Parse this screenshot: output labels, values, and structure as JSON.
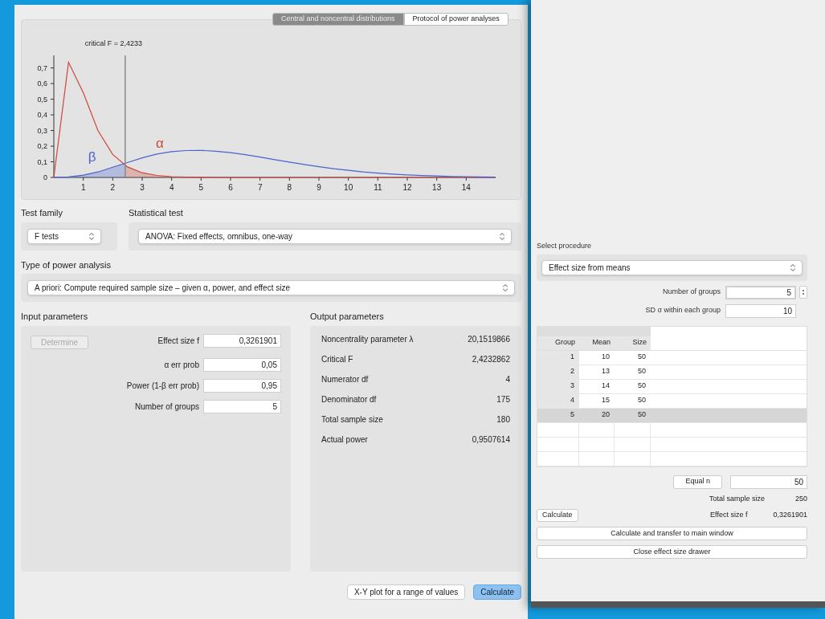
{
  "tabs": [
    {
      "label": "Central and noncentral distributions",
      "selected": true
    },
    {
      "label": "Protocol of power analyses",
      "selected": false
    }
  ],
  "chart": {
    "chart_data": {
      "type": "line",
      "x": [
        0,
        0.5,
        1,
        1.5,
        2,
        2.5,
        3,
        3.5,
        4,
        4.5,
        5,
        5.5,
        6,
        6.5,
        7,
        7.5,
        8,
        8.5,
        9,
        9.5,
        10,
        10.5,
        11,
        11.5,
        12,
        12.5,
        13,
        13.5,
        14,
        14.5,
        15
      ],
      "series": [
        {
          "color": "#d0463c",
          "values": [
            0,
            0.736,
            0.541,
            0.299,
            0.147,
            0.067,
            0.03,
            0.013,
            0.005,
            0.002,
            0.001,
            0,
            0,
            0,
            0,
            0,
            0,
            0,
            0,
            0,
            0,
            0,
            0,
            0,
            0,
            0,
            0,
            0,
            0,
            0,
            0
          ]
        },
        {
          "color": "#4a63d0",
          "values": [
            0,
            0.003,
            0.015,
            0.035,
            0.065,
            0.095,
            0.125,
            0.15,
            0.165,
            0.172,
            0.173,
            0.168,
            0.158,
            0.145,
            0.13,
            0.114,
            0.098,
            0.083,
            0.069,
            0.056,
            0.045,
            0.035,
            0.027,
            0.021,
            0.016,
            0.012,
            0.009,
            0.006,
            0.005,
            0.003,
            0.002
          ]
        }
      ],
      "xlim": [
        0,
        15
      ],
      "ylim": [
        0,
        0.78
      ],
      "xticks": [
        1,
        2,
        3,
        4,
        5,
        6,
        7,
        8,
        9,
        10,
        11,
        12,
        13,
        14
      ],
      "yticks": [
        {
          "value": 0,
          "label": "0"
        },
        {
          "value": 0.1,
          "label": "0,1"
        },
        {
          "value": 0.2,
          "label": "0,2"
        },
        {
          "value": 0.3,
          "label": "0,3"
        },
        {
          "value": 0.4,
          "label": "0,4"
        },
        {
          "value": 0.5,
          "label": "0,5"
        },
        {
          "value": 0.6,
          "label": "0,6"
        },
        {
          "value": 0.7,
          "label": "0,7"
        }
      ],
      "ref_lines": [
        {
          "axis": "x",
          "value": 2.4233,
          "label": "critical F = 2,4233"
        }
      ]
    },
    "area_labels": [
      {
        "text": "β",
        "color": "#4a63d0"
      },
      {
        "text": "α",
        "color": "#d0463c"
      }
    ]
  },
  "test_family": {
    "label": "Test family",
    "value": "F tests"
  },
  "statistical_test": {
    "label": "Statistical test",
    "value": "ANOVA: Fixed effects, omnibus, one-way"
  },
  "power_analysis_type": {
    "label": "Type of power analysis",
    "value": "A priori: Compute required sample size – given α, power, and effect size"
  },
  "input_parameters": {
    "title": "Input parameters",
    "determine_button": {
      "label": "Determine",
      "disabled": true
    },
    "fields": [
      {
        "label": "Effect size f",
        "value": "0,3261901"
      },
      {
        "label": "α err prob",
        "value": "0,05"
      },
      {
        "label": "Power (1-β err prob)",
        "value": "0,95"
      },
      {
        "label": "Number of groups",
        "value": "5"
      }
    ]
  },
  "output_parameters": {
    "title": "Output parameters",
    "rows": [
      {
        "label": "Noncentrality parameter λ",
        "value": "20,1519866"
      },
      {
        "label": "Critical F",
        "value": "2,4232862"
      },
      {
        "label": "Numerator df",
        "value": "4"
      },
      {
        "label": "Denominator df",
        "value": "175"
      },
      {
        "label": "Total sample size",
        "value": "180"
      },
      {
        "label": "Actual power",
        "value": "0,9507614"
      }
    ]
  },
  "buttons": [
    {
      "label": "X-Y plot for a range of values",
      "default": false
    },
    {
      "label": "Calculate",
      "default": true
    }
  ],
  "drawer": {
    "procedure_label": "Select procedure",
    "procedure": "Effect size from means",
    "number_of_groups": {
      "label": "Number of groups",
      "value": "5"
    },
    "sd": {
      "label": "SD σ within each group",
      "value": "10"
    },
    "table": {
      "columns": [
        "Group",
        "Mean",
        "Size"
      ],
      "rows": [
        {
          "cells": [
            "1",
            "10",
            "50"
          ],
          "selected": false
        },
        {
          "cells": [
            "2",
            "13",
            "50"
          ],
          "selected": false
        },
        {
          "cells": [
            "3",
            "14",
            "50"
          ],
          "selected": false
        },
        {
          "cells": [
            "4",
            "15",
            "50"
          ],
          "selected": false
        },
        {
          "cells": [
            "5",
            "20",
            "50"
          ],
          "selected": true
        }
      ]
    },
    "equal_n": {
      "label": "Equal n",
      "value": "50"
    },
    "total_sample_size": {
      "label": "Total sample size",
      "value": "250"
    },
    "calculate": "Calculate",
    "effect_size": {
      "label": "Effect size f",
      "value": "0,3261901"
    },
    "transfer_button": "Calculate and transfer to main window",
    "close_button": "Close effect size drawer"
  }
}
